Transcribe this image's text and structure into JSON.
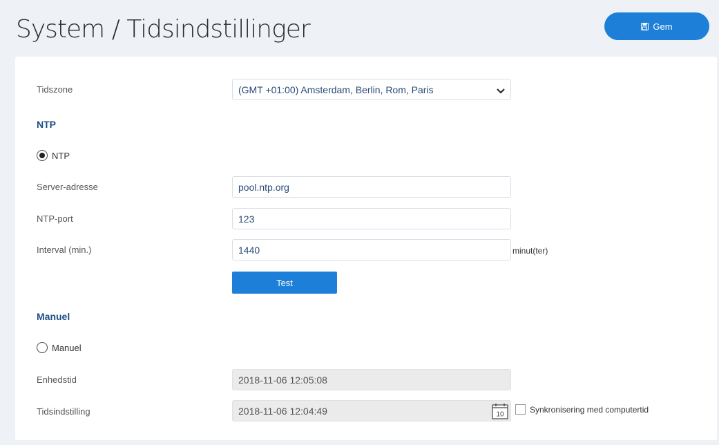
{
  "header": {
    "title": "System / Tidsindstillinger",
    "save_label": "Gem"
  },
  "form": {
    "timezone": {
      "label": "Tidszone",
      "value": "(GMT +01:00) Amsterdam, Berlin, Rom, Paris"
    },
    "ntp_section": "NTP",
    "ntp_radio": {
      "label": "NTP",
      "checked": true
    },
    "server": {
      "label": "Server-adresse",
      "value": "pool.ntp.org"
    },
    "port": {
      "label": "NTP-port",
      "value": "123"
    },
    "interval": {
      "label": "Interval (min.)",
      "value": "1440",
      "unit": "minut(ter)"
    },
    "test_label": "Test",
    "manual_section": "Manuel",
    "manual_radio": {
      "label": "Manuel",
      "checked": false
    },
    "device_time": {
      "label": "Enhedstid",
      "value": "2018-11-06 12:05:08"
    },
    "time_setting": {
      "label": "Tidsindstilling",
      "value": "2018-11-06 12:04:49"
    },
    "calendar_day": "10",
    "sync_label": "Synkronisering med computertid"
  },
  "colors": {
    "accent": "#1d7fd8",
    "section_title": "#1f4e86",
    "background": "#eef1f5"
  }
}
